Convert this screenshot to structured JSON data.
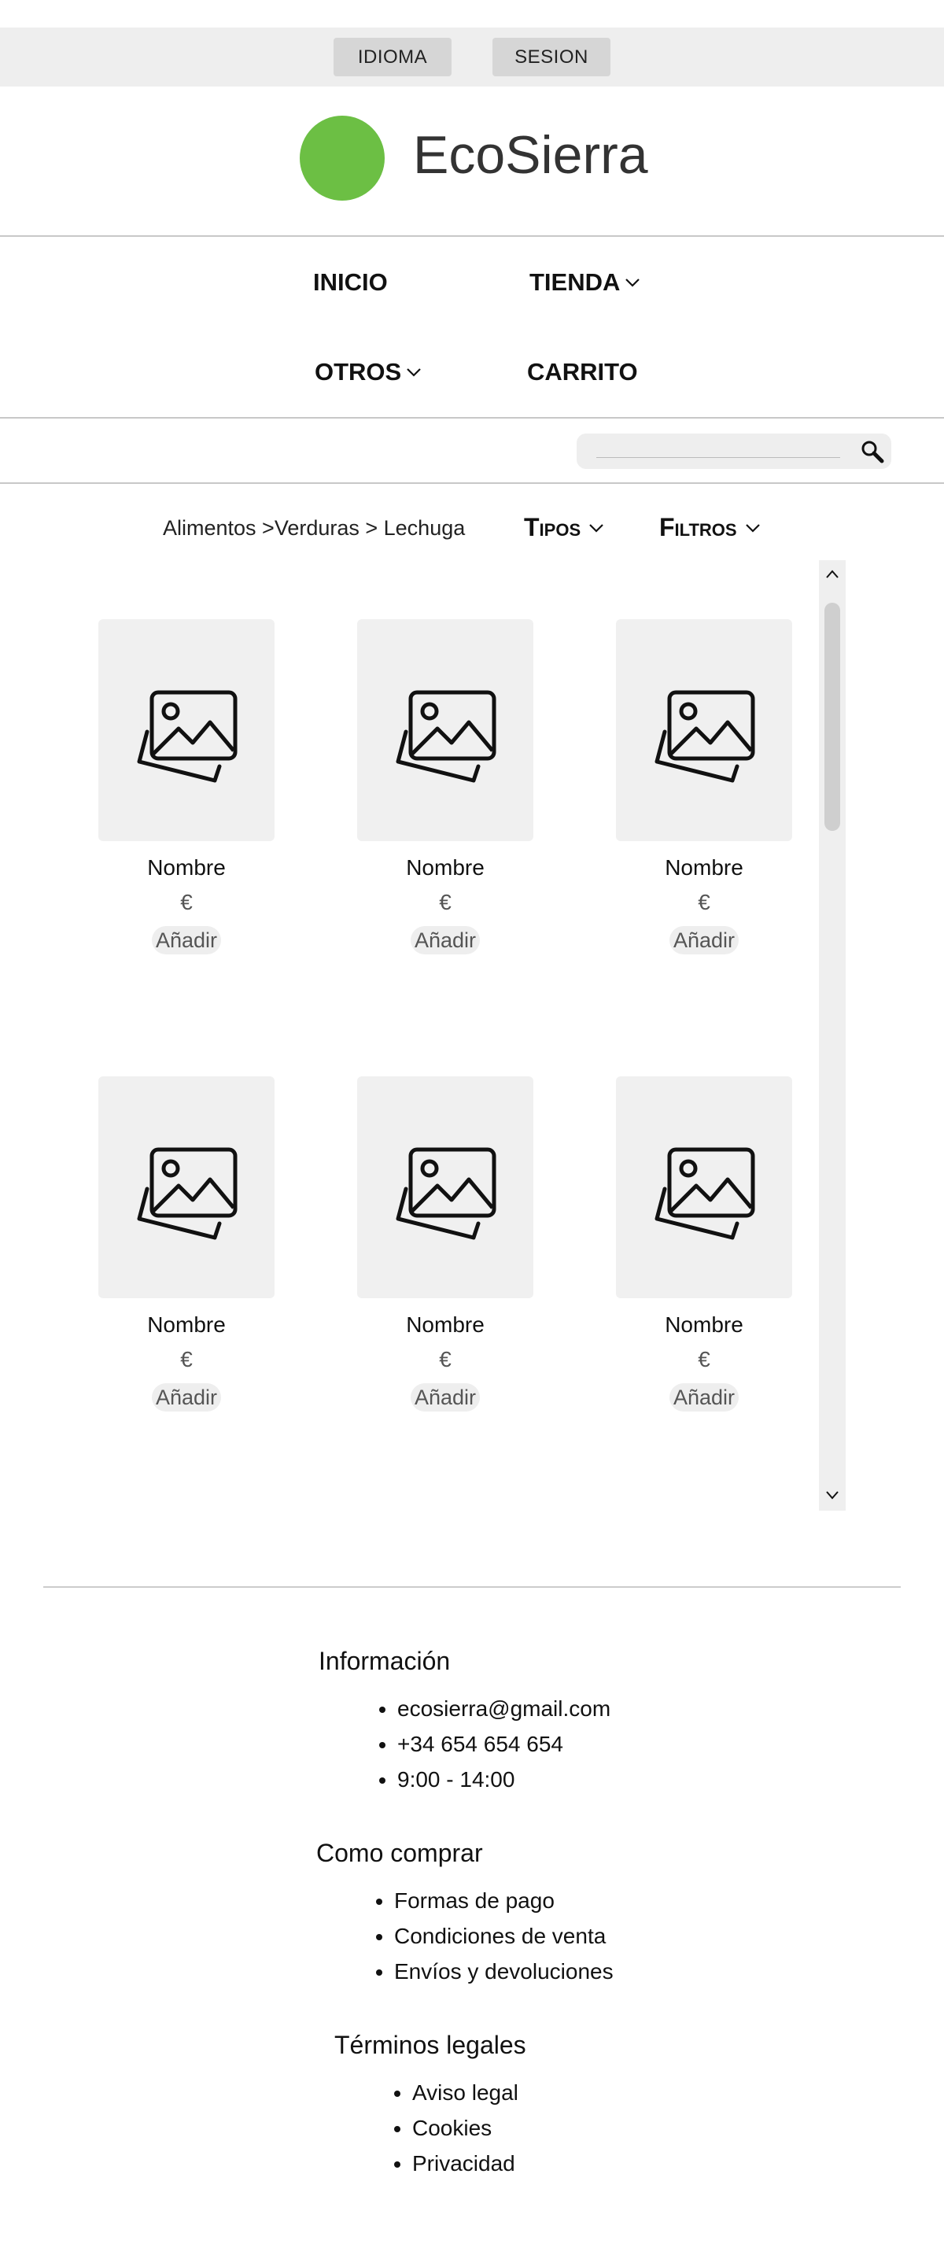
{
  "topbar": {
    "language_label": "IDIOMA",
    "session_label": "SESION"
  },
  "brand": {
    "name": "EcoSierra",
    "logo_color": "#6cbf44"
  },
  "nav": {
    "home": "INICIO",
    "shop": "TIENDA",
    "others": "OTROS",
    "cart": "CARRITO"
  },
  "search": {
    "placeholder": ""
  },
  "breadcrumb": {
    "text": "Alimentos >Verduras > Lechuga"
  },
  "filters": {
    "types_label": "Tipos",
    "filters_label": "Filtros"
  },
  "products": [
    {
      "name": "Nombre",
      "price": "€",
      "add_label": "Añadir"
    },
    {
      "name": "Nombre",
      "price": "€",
      "add_label": "Añadir"
    },
    {
      "name": "Nombre",
      "price": "€",
      "add_label": "Añadir"
    },
    {
      "name": "Nombre",
      "price": "€",
      "add_label": "Añadir"
    },
    {
      "name": "Nombre",
      "price": "€",
      "add_label": "Añadir"
    },
    {
      "name": "Nombre",
      "price": "€",
      "add_label": "Añadir"
    }
  ],
  "footer": {
    "info": {
      "title": "Información",
      "items": [
        "ecosierra@gmail.com",
        "+34 654 654 654",
        "9:00 - 14:00"
      ]
    },
    "howto": {
      "title": "Como comprar",
      "items": [
        "Formas de pago",
        "Condiciones de venta",
        "Envíos y devoluciones"
      ]
    },
    "legal": {
      "title": "Términos legales",
      "items": [
        "Aviso legal",
        "Cookies",
        "Privacidad"
      ]
    }
  }
}
